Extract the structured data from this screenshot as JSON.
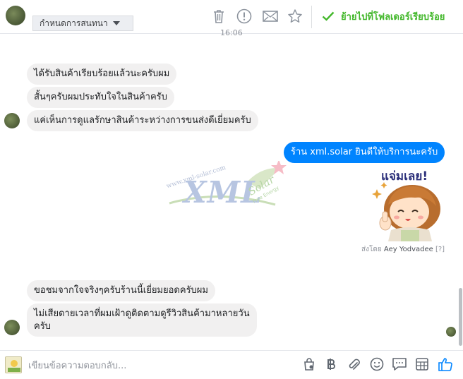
{
  "header": {
    "label_dropdown": "กำหนดการสนทนา",
    "moved_text": "ย้ายไปที่โฟลเดอร์เรียบร้อย",
    "icons": [
      "trash-icon",
      "alert-icon",
      "envelope-icon",
      "star-icon",
      "check-icon"
    ]
  },
  "timestamp": "16:06",
  "messages_block1": [
    "ได้รับสินค้าเรียบร้อยแล้วนะครับผม",
    "สั้นๆครับผมประทับใจในสินค้าครับ",
    "แค่เห็นการดูแลรักษาสินค้าระหว่างการขนส่งดีเยี่ยมครับ"
  ],
  "outgoing": {
    "message": "ร้าน xml.solar ยินดีให้บริการนะครับ",
    "sticker_text": "แจ่มเลย!",
    "sent_by_prefix": "ส่งโดย",
    "sent_by_name": "Aey Yodvadee",
    "sent_by_help": "[?]"
  },
  "watermark": {
    "url": "www.xml-solar.com",
    "logo": "XML",
    "solar": "Solar",
    "sub": "Free Energy"
  },
  "messages_block2": [
    "ขอชมจากใจจริงๆครับร้านนี้เยี่ยมยอดครับผม",
    "ไม่เสียดายเวลาที่ผมเฝ้าดูติดตามดูรีวิวสินค้ามาหลายวัน",
    "ครับ"
  ],
  "composer": {
    "placeholder": "เขียนข้อความตอบกลับ...",
    "icons": [
      "bag-icon",
      "baht-icon",
      "paperclip-icon",
      "smiley-icon",
      "saved-reply-icon",
      "grid-icon",
      "like-icon"
    ]
  },
  "colors": {
    "accent_blue": "#0084ff",
    "success_green": "#42b72a",
    "bubble_gray": "#f1f0f0"
  }
}
